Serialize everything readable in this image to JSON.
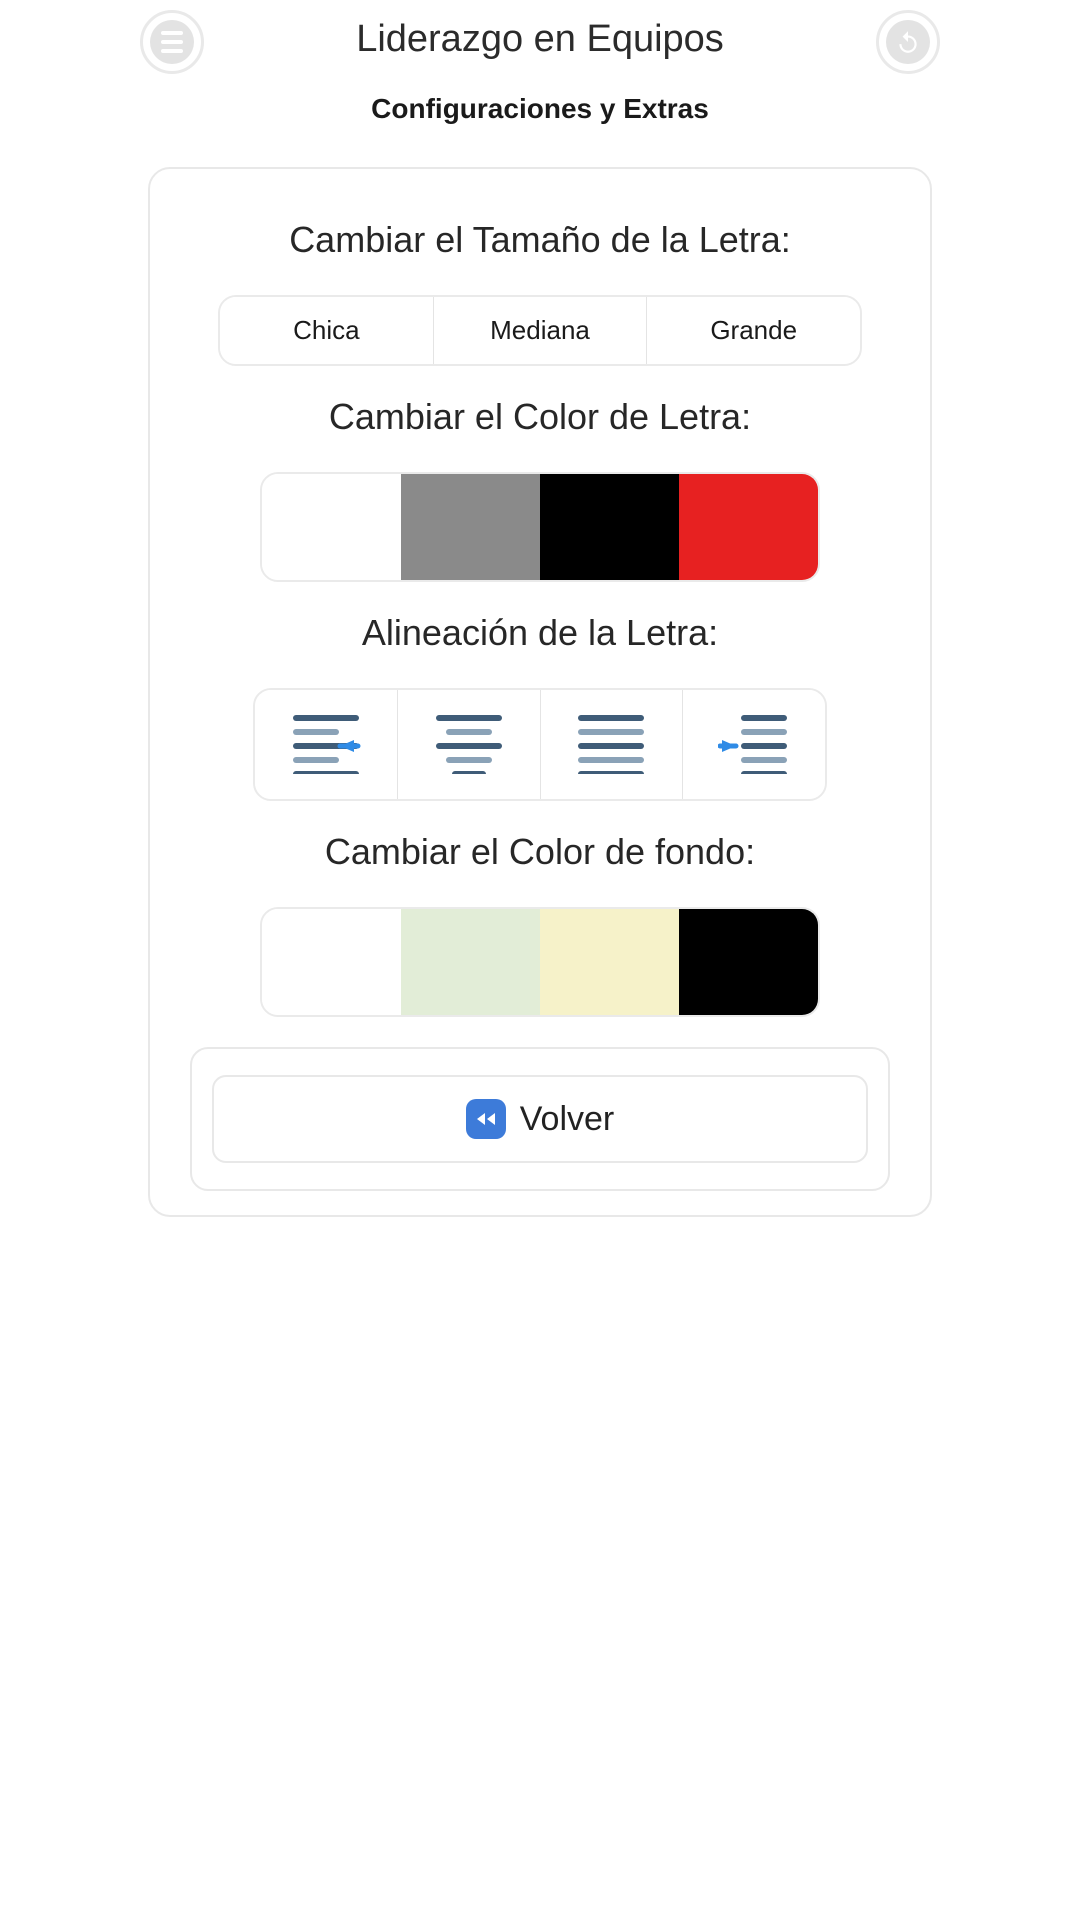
{
  "header": {
    "title": "Liderazgo en Equipos",
    "subtitle": "Configuraciones y Extras"
  },
  "sections": {
    "font_size_title": "Cambiar el Tamaño de la Letra:",
    "font_size_options": [
      "Chica",
      "Mediana",
      "Grande"
    ],
    "font_color_title": "Cambiar el Color de Letra:",
    "font_colors": [
      "#ffffff",
      "#8a8a8a",
      "#000000",
      "#e72121"
    ],
    "alignment_title": "Alineación de la Letra:",
    "bg_color_title": "Cambiar el Color de fondo:",
    "bg_colors": [
      "#ffffff",
      "#e2edd7",
      "#f6f2c9",
      "#000000"
    ]
  },
  "footer": {
    "back_label": "Volver"
  },
  "icons": {
    "menu": "menu-icon",
    "back_round": "undo-icon",
    "rewind": "rewind-icon",
    "align_left_indent": "align-indent-left-icon",
    "align_center": "align-center-icon",
    "align_justify": "align-justify-icon",
    "align_right_indent": "align-indent-right-icon"
  },
  "colors": {
    "accent_blue": "#2f8be6",
    "line_dark": "#3f5c78",
    "line_light": "#8aa2b7"
  }
}
